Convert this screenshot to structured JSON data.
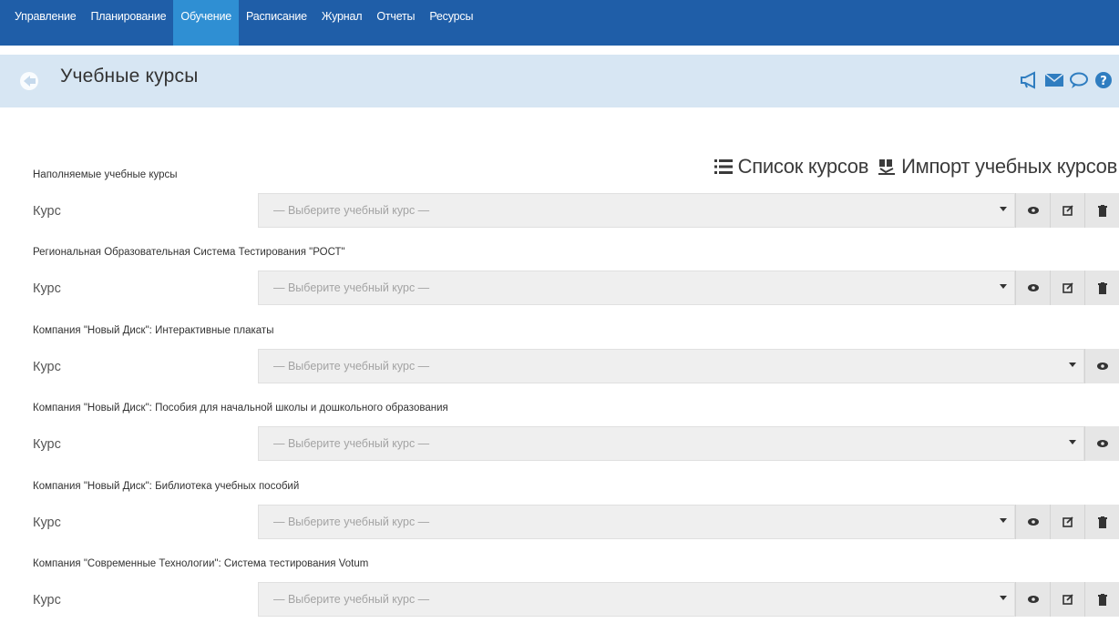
{
  "nav": {
    "items": [
      {
        "label": "Управление",
        "x": 0
      },
      {
        "label": "Планирование",
        "x": 0
      },
      {
        "label": "Обучение",
        "x": 0
      },
      {
        "label": "Расписание",
        "x": 0
      },
      {
        "label": "Журнал",
        "x": 0
      },
      {
        "label": "Отчеты",
        "x": 0
      },
      {
        "label": "Ресурсы",
        "x": 0
      }
    ],
    "active_index": 2,
    "active_color": "#2f8fd3",
    "bar_color": "#1f5ea8"
  },
  "header": {
    "title": "Учебные курсы",
    "icons": [
      "megaphone-icon",
      "envelope-icon",
      "chat-icon",
      "help-icon"
    ]
  },
  "actions": {
    "list_label": "Список курсов",
    "import_label": "Импорт учебных курсов"
  },
  "sections": [
    {
      "title": "Наполняемые учебные курсы",
      "label": "Курс",
      "placeholder": "— Выберите учебный курс —",
      "buttons": [
        "view",
        "edit",
        "delete"
      ]
    },
    {
      "title": "Региональная Образовательная Система Тестирования \"РОСТ\"",
      "label": "Курс",
      "placeholder": "— Выберите учебный курс —",
      "buttons": [
        "view",
        "edit",
        "delete"
      ]
    },
    {
      "title": "Компания \"Новый Диск\": Интерактивные плакаты",
      "label": "Курс",
      "placeholder": "— Выберите учебный курс —",
      "buttons": [
        "view"
      ]
    },
    {
      "title": "Компания \"Новый Диск\": Пособия для начальной школы и дошкольного образования",
      "label": "Курс",
      "placeholder": "— Выберите учебный курс —",
      "buttons": [
        "view"
      ]
    },
    {
      "title": "Компания \"Новый Диск\": Библиотека учебных пособий",
      "label": "Курс",
      "placeholder": "— Выберите учебный курс —",
      "buttons": [
        "view",
        "edit",
        "delete"
      ]
    },
    {
      "title": "Компания \"Современные Технологии\": Система тестирования Votum",
      "label": "Курс",
      "placeholder": "— Выберите учебный курс —",
      "buttons": [
        "view",
        "edit",
        "delete"
      ]
    }
  ]
}
